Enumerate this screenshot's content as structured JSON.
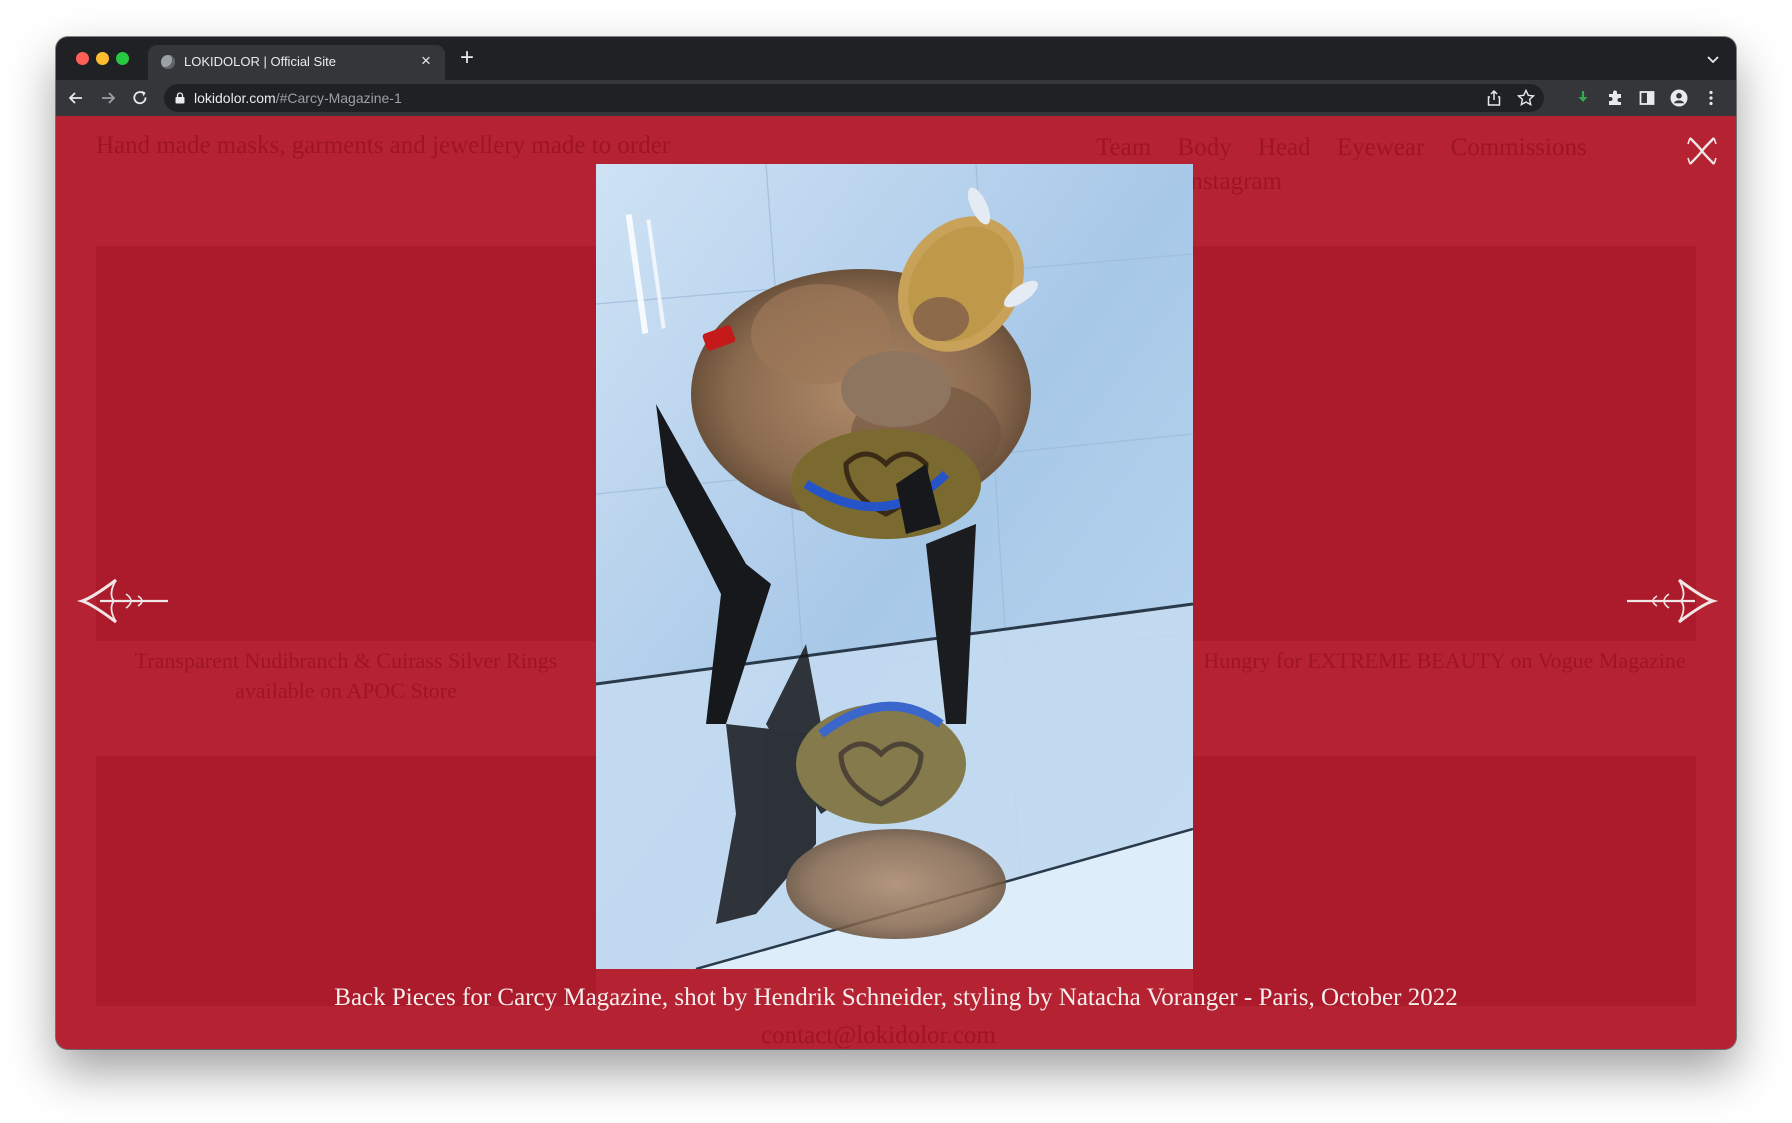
{
  "browser": {
    "tab_title": "LOKIDOLOR | Official Site",
    "tab_close": "×",
    "new_tab": "+",
    "url_host": "lokidolor.com",
    "url_path": "/#Carcy-Magazine-1"
  },
  "page": {
    "tagline": "Hand made masks, garments and jewellery made to order",
    "nav": [
      "Team",
      "Body",
      "Head",
      "Eyewear",
      "Commissions",
      "Instagram"
    ],
    "background_captions": [
      "Transparent Nudibranch & Cuirass Silver Rings available on APOC Store",
      "Hungry for EXTREME BEAUTY on Vogue Magazine"
    ],
    "footer_email": "contact@lokidolor.com"
  },
  "gallery": {
    "caption": "Back Pieces for Carcy Magazine, shot by Hendrik Schneider, styling by Natacha Voranger - Paris, October 2022",
    "image_alt": "Back pieces worn by a model in fur and black boots, reflected in a mirror"
  },
  "colors": {
    "page_background": "#b52232",
    "chrome_dark": "#202124",
    "chrome_toolbar": "#35363a"
  },
  "icons": [
    "back-icon",
    "forward-icon",
    "reload-icon",
    "lock-icon",
    "share-icon",
    "bookmark-star-icon",
    "download-icon",
    "extensions-icon",
    "sidebar-icon",
    "profile-icon",
    "menu-icon",
    "prev-arrow-icon",
    "next-arrow-icon",
    "close-gallery-icon"
  ]
}
